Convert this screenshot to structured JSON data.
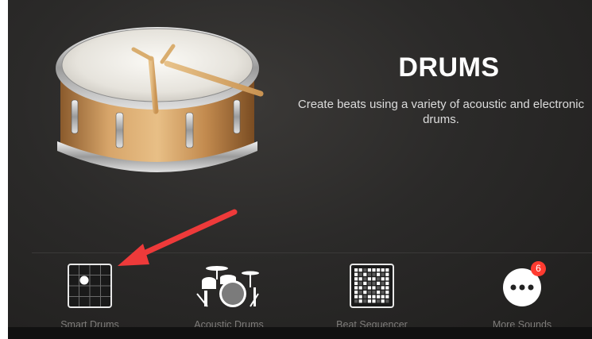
{
  "header": {
    "title": "DRUMS",
    "description": "Create beats using a variety of acoustic and electronic drums."
  },
  "options": [
    {
      "label": "Smart Drums",
      "icon": "smart-drums-grid-icon"
    },
    {
      "label": "Acoustic Drums",
      "icon": "drum-kit-icon"
    },
    {
      "label": "Beat Sequencer",
      "icon": "beat-sequencer-icon"
    },
    {
      "label": "More Sounds",
      "icon": "more-icon",
      "badge": "6"
    }
  ],
  "colors": {
    "background": "#2b2a29",
    "label": "#7e7c7a",
    "badge": "#ff3b30",
    "annotation_arrow": "#ee3a3a"
  }
}
